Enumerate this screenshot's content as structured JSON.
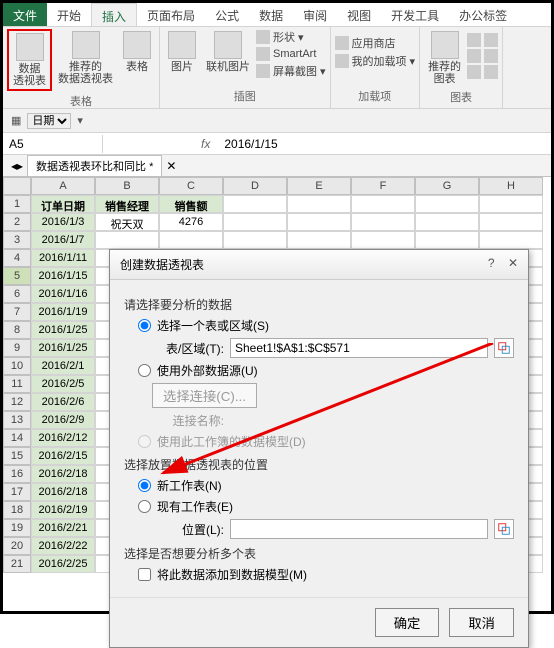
{
  "tabs": {
    "file": "文件",
    "home": "开始",
    "insert": "插入",
    "layout": "页面布局",
    "formula": "公式",
    "data": "数据",
    "review": "审阅",
    "view": "视图",
    "dev": "开发工具",
    "office": "办公标签"
  },
  "ribbon": {
    "pivot": "数据\n透视表",
    "rec_pivot": "推荐的\n数据透视表",
    "table": "表格",
    "group_tables": "表格",
    "pic": "图片",
    "online_pic": "联机图片",
    "shapes": "形状",
    "smartart": "SmartArt",
    "screenshot": "屏幕截图",
    "group_illus": "插图",
    "store": "应用商店",
    "myaddins": "我的加载项",
    "group_addins": "加载项",
    "rec_chart": "推荐的\n图表",
    "group_charts": "图表"
  },
  "qat": {
    "date_lbl": "日期"
  },
  "formula_bar": {
    "name": "A5",
    "fx": "fx",
    "value": "2016/1/15"
  },
  "sheet_tab": "数据透视表环比和同比 *",
  "columns": [
    "A",
    "B",
    "C",
    "D",
    "E",
    "F",
    "G",
    "H"
  ],
  "headers": [
    "订单日期",
    "销售经理",
    "销售额"
  ],
  "rows": [
    {
      "n": 1
    },
    {
      "n": 2,
      "date": "2016/1/3",
      "mgr": "祝天双",
      "amt": "4276"
    },
    {
      "n": 3,
      "date": "2016/1/7"
    },
    {
      "n": 4,
      "date": "2016/1/11"
    },
    {
      "n": 5,
      "date": "2016/1/15"
    },
    {
      "n": 6,
      "date": "2016/1/16"
    },
    {
      "n": 7,
      "date": "2016/1/19"
    },
    {
      "n": 8,
      "date": "2016/1/25"
    },
    {
      "n": 9,
      "date": "2016/1/25"
    },
    {
      "n": 10,
      "date": "2016/2/1"
    },
    {
      "n": 11,
      "date": "2016/2/5"
    },
    {
      "n": 12,
      "date": "2016/2/6"
    },
    {
      "n": 13,
      "date": "2016/2/9"
    },
    {
      "n": 14,
      "date": "2016/2/12"
    },
    {
      "n": 15,
      "date": "2016/2/15"
    },
    {
      "n": 16,
      "date": "2016/2/18"
    },
    {
      "n": 17,
      "date": "2016/2/18"
    },
    {
      "n": 18,
      "date": "2016/2/19"
    },
    {
      "n": 19,
      "date": "2016/2/21"
    },
    {
      "n": 20,
      "date": "2016/2/22"
    },
    {
      "n": 21,
      "date": "2016/2/25"
    }
  ],
  "dialog": {
    "title": "创建数据透视表",
    "sec1": "请选择要分析的数据",
    "opt_range": "选择一个表或区域(S)",
    "range_lbl": "表/区域(T):",
    "range_val": "Sheet1!$A$1:$C$571",
    "opt_ext": "使用外部数据源(U)",
    "conn_btn": "选择连接(C)...",
    "conn_lbl": "连接名称:",
    "opt_model": "使用此工作簿的数据模型(D)",
    "sec2": "选择放置数据透视表的位置",
    "opt_new": "新工作表(N)",
    "opt_exist": "现有工作表(E)",
    "loc_lbl": "位置(L):",
    "sec3": "选择是否想要分析多个表",
    "chk_model": "将此数据添加到数据模型(M)",
    "ok": "确定",
    "cancel": "取消"
  }
}
